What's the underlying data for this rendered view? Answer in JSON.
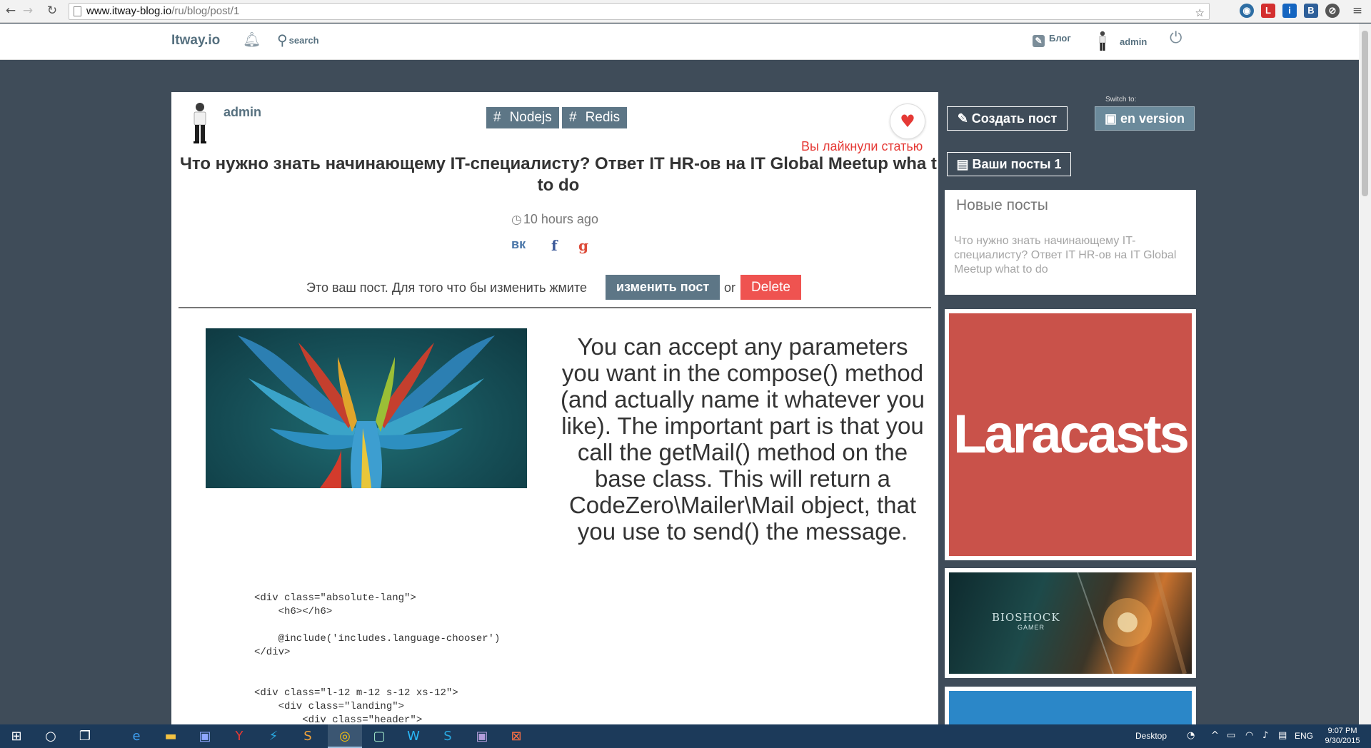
{
  "browser": {
    "url_host": "www.itway-blog.io",
    "url_path": "/ru/blog/post/1"
  },
  "header": {
    "logo": "Itway.io",
    "search_label": "search",
    "blog_label": "Блог",
    "user_label": "admin"
  },
  "post": {
    "author": "admin",
    "tags": [
      {
        "hash": "#",
        "label": "Nodejs"
      },
      {
        "hash": "#",
        "label": "Redis"
      }
    ],
    "liked_text": "Вы лайкнули статью",
    "title": "Что нужно знать начинающему IT-специалисту? Ответ IT HR-ов на IT Global Meetup wha t to do",
    "time": "10 hours ago",
    "share_icons": [
      "vk-icon",
      "facebook-icon",
      "google-plus-icon"
    ],
    "share_glyphs": {
      "vk": "вк",
      "facebook": "f",
      "google": "g"
    },
    "edit_text": "Это ваш пост. Для того что бы изменить жмите",
    "edit_button": "изменить пост",
    "or_text": "or",
    "delete_button": "Delete",
    "body_text": "You can accept any parameters you want in the compose() method (and actually name it whatever you like). The important part is that you call the getMail() method on the base class. This will return a CodeZero\\Mailer\\Mail object, that you use to send() the message.",
    "code": "<div class=\"absolute-lang\">\n    <h6></h6>\n\n    @include('includes.language-chooser')\n</div>\n\n\n<div class=\"l-12 m-12 s-12 xs-12\">\n    <div class=\"landing\">\n        <div class=\"header\">"
  },
  "sidebar": {
    "create_post": "Создать пост",
    "switch_label": "Switch to:",
    "lang_button": "en version",
    "my_posts": "Ваши посты 1",
    "new_posts_title": "Новые посты",
    "new_post_link": "Что нужно знать начинающему IT-специалисту? Ответ IT HR-ов на IT Global Meetup what to do",
    "ad_laracasts": "Laracasts",
    "ad_bioshock": "BIOSHOCK",
    "ad_bioshock_sub": "GAMER"
  },
  "taskbar": {
    "desktop_label": "Desktop",
    "lang": "ENG",
    "time": "9:07 PM",
    "date": "9/30/2015"
  },
  "colors": {
    "accent": "#5d7686",
    "danger": "#ef5350",
    "like": "#e53935",
    "page_bg": "#3f4c59",
    "laracasts": "#c9524a"
  }
}
